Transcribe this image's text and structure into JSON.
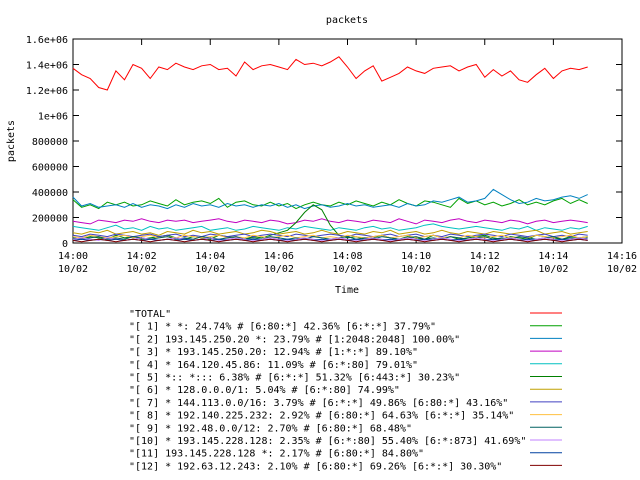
{
  "chart_data": {
    "type": "line",
    "title": "packets",
    "xlabel": "Time",
    "ylabel": "packets",
    "ylim": [
      0,
      1600000
    ],
    "xlim": [
      "14:00 10/02",
      "14:16 10/02"
    ],
    "grid": false,
    "legend_position": "below",
    "y_ticks": [
      0,
      200000,
      400000,
      600000,
      800000,
      1000000,
      1200000,
      1400000,
      1600000
    ],
    "y_tick_labels": [
      "0",
      "200000",
      "400000",
      "600000",
      "800000",
      "1e+06",
      "1.2e+06",
      "1.4e+06",
      "1.6e+06"
    ],
    "x_ticks": [
      0,
      2,
      4,
      6,
      8,
      10,
      12,
      14,
      16
    ],
    "x_tick_labels": [
      {
        "time": "14:00",
        "date": "10/02"
      },
      {
        "time": "14:02",
        "date": "10/02"
      },
      {
        "time": "14:04",
        "date": "10/02"
      },
      {
        "time": "14:06",
        "date": "10/02"
      },
      {
        "time": "14:08",
        "date": "10/02"
      },
      {
        "time": "14:10",
        "date": "10/02"
      },
      {
        "time": "14:12",
        "date": "10/02"
      },
      {
        "time": "14:14",
        "date": "10/02"
      },
      {
        "time": "14:16",
        "date": "10/02"
      }
    ],
    "x_minutes": [
      0,
      0.25,
      0.5,
      0.75,
      1,
      1.25,
      1.5,
      1.75,
      2,
      2.25,
      2.5,
      2.75,
      3,
      3.25,
      3.5,
      3.75,
      4,
      4.25,
      4.5,
      4.75,
      5,
      5.25,
      5.5,
      5.75,
      6,
      6.25,
      6.5,
      6.75,
      7,
      7.25,
      7.5,
      7.75,
      8,
      8.25,
      8.5,
      8.75,
      9,
      9.25,
      9.5,
      9.75,
      10,
      10.25,
      10.5,
      10.75,
      11,
      11.25,
      11.5,
      11.75,
      12,
      12.25,
      12.5,
      12.75,
      13,
      13.25,
      13.5,
      13.75,
      14,
      14.25,
      14.5,
      14.75,
      15
    ],
    "series": [
      {
        "name": "\"TOTAL\"",
        "color": "#ff0000",
        "values": [
          1370000,
          1320000,
          1290000,
          1220000,
          1200000,
          1350000,
          1280000,
          1400000,
          1370000,
          1290000,
          1380000,
          1360000,
          1410000,
          1380000,
          1360000,
          1390000,
          1400000,
          1360000,
          1370000,
          1310000,
          1420000,
          1360000,
          1390000,
          1400000,
          1380000,
          1360000,
          1440000,
          1400000,
          1410000,
          1390000,
          1420000,
          1460000,
          1380000,
          1290000,
          1350000,
          1390000,
          1270000,
          1300000,
          1330000,
          1380000,
          1350000,
          1330000,
          1370000,
          1380000,
          1390000,
          1350000,
          1380000,
          1400000,
          1300000,
          1360000,
          1310000,
          1350000,
          1280000,
          1260000,
          1320000,
          1370000,
          1290000,
          1350000,
          1370000,
          1360000,
          1380000
        ]
      },
      {
        "name": "\"[ 1] * *: 24.74% # [6:80:*] 42.36% [6:*:*] 37.79%\"",
        "color": "#00a000",
        "values": [
          340000,
          280000,
          300000,
          270000,
          320000,
          300000,
          320000,
          290000,
          300000,
          330000,
          310000,
          290000,
          340000,
          300000,
          320000,
          330000,
          310000,
          350000,
          280000,
          320000,
          330000,
          300000,
          290000,
          320000,
          290000,
          310000,
          270000,
          300000,
          320000,
          300000,
          290000,
          320000,
          300000,
          330000,
          310000,
          290000,
          320000,
          300000,
          340000,
          310000,
          290000,
          330000,
          320000,
          300000,
          280000,
          350000,
          310000,
          330000,
          300000,
          320000,
          290000,
          310000,
          340000,
          300000,
          320000,
          300000,
          330000,
          350000,
          310000,
          340000,
          310000
        ]
      },
      {
        "name": "\"[ 2] 193.145.250.20 *: 23.79% # [1:2048:2048] 100.00%\"",
        "color": "#0080c0",
        "values": [
          360000,
          290000,
          310000,
          280000,
          290000,
          300000,
          280000,
          310000,
          280000,
          300000,
          290000,
          270000,
          300000,
          280000,
          310000,
          290000,
          300000,
          280000,
          310000,
          290000,
          300000,
          280000,
          300000,
          290000,
          310000,
          280000,
          300000,
          270000,
          290000,
          300000,
          280000,
          290000,
          310000,
          290000,
          300000,
          280000,
          290000,
          300000,
          280000,
          310000,
          290000,
          300000,
          330000,
          320000,
          340000,
          360000,
          320000,
          330000,
          350000,
          420000,
          380000,
          340000,
          310000,
          320000,
          350000,
          330000,
          340000,
          360000,
          370000,
          350000,
          380000
        ]
      },
      {
        "name": "\"[ 3] * 193.145.250.20: 12.94% # [1:*:*] 89.10%\"",
        "color": "#c000c0",
        "values": [
          170000,
          160000,
          150000,
          180000,
          170000,
          160000,
          180000,
          170000,
          190000,
          170000,
          160000,
          180000,
          170000,
          180000,
          160000,
          170000,
          180000,
          190000,
          170000,
          160000,
          180000,
          170000,
          160000,
          180000,
          170000,
          150000,
          160000,
          180000,
          170000,
          190000,
          170000,
          160000,
          180000,
          170000,
          160000,
          180000,
          170000,
          160000,
          190000,
          170000,
          150000,
          180000,
          170000,
          160000,
          180000,
          190000,
          170000,
          160000,
          180000,
          170000,
          160000,
          180000,
          170000,
          150000,
          170000,
          180000,
          160000,
          170000,
          180000,
          170000,
          160000
        ]
      },
      {
        "name": "\"[ 4] * 164.120.45.86: 11.09% # [6:*:80] 79.01%\"",
        "color": "#00c0c0",
        "values": [
          130000,
          120000,
          110000,
          100000,
          120000,
          140000,
          110000,
          120000,
          100000,
          130000,
          110000,
          120000,
          100000,
          110000,
          120000,
          130000,
          100000,
          110000,
          120000,
          100000,
          110000,
          130000,
          120000,
          110000,
          100000,
          120000,
          110000,
          130000,
          120000,
          110000,
          100000,
          120000,
          110000,
          100000,
          120000,
          130000,
          110000,
          120000,
          100000,
          110000,
          120000,
          140000,
          150000,
          130000,
          120000,
          110000,
          120000,
          130000,
          120000,
          110000,
          100000,
          120000,
          110000,
          130000,
          100000,
          120000,
          110000,
          100000,
          120000,
          110000,
          130000
        ]
      },
      {
        "name": "\"[ 5] *:: *::: 6.38% # [6:*:*] 51.32% [6:443:*] 30.23%\"",
        "color": "#008000",
        "values": [
          40000,
          30000,
          50000,
          40000,
          30000,
          60000,
          40000,
          50000,
          30000,
          40000,
          50000,
          60000,
          40000,
          30000,
          50000,
          40000,
          30000,
          60000,
          50000,
          40000,
          30000,
          50000,
          40000,
          60000,
          80000,
          100000,
          160000,
          240000,
          300000,
          260000,
          140000,
          60000,
          40000,
          50000,
          30000,
          40000,
          60000,
          40000,
          30000,
          50000,
          40000,
          30000,
          60000,
          40000,
          50000,
          30000,
          40000,
          50000,
          60000,
          40000,
          30000,
          50000,
          40000,
          30000,
          60000,
          50000,
          40000,
          30000,
          50000,
          40000,
          50000
        ]
      },
      {
        "name": "\"[ 6] * 128.0.0.0/1: 5.04% # [6:*:80] 74.99%\"",
        "color": "#c0a000",
        "values": [
          80000,
          70000,
          90000,
          80000,
          100000,
          70000,
          80000,
          90000,
          70000,
          80000,
          60000,
          90000,
          80000,
          70000,
          100000,
          80000,
          90000,
          70000,
          80000,
          90000,
          70000,
          80000,
          100000,
          90000,
          70000,
          80000,
          90000,
          70000,
          80000,
          100000,
          80000,
          70000,
          90000,
          80000,
          70000,
          90000,
          80000,
          100000,
          70000,
          80000,
          90000,
          70000,
          80000,
          100000,
          80000,
          70000,
          90000,
          80000,
          70000,
          90000,
          80000,
          70000,
          80000,
          90000,
          100000,
          70000,
          80000,
          90000,
          70000,
          80000,
          90000
        ]
      },
      {
        "name": "\"[ 7] * 144.113.0.0/16: 3.79% # [6:*:*] 49.86% [6:80:*] 43.16%\"",
        "color": "#4040c0",
        "values": [
          60000,
          50000,
          70000,
          60000,
          50000,
          70000,
          60000,
          50000,
          60000,
          70000,
          50000,
          60000,
          70000,
          50000,
          60000,
          50000,
          70000,
          60000,
          50000,
          60000,
          70000,
          50000,
          60000,
          70000,
          60000,
          50000,
          70000,
          60000,
          50000,
          60000,
          70000,
          60000,
          50000,
          70000,
          60000,
          50000,
          60000,
          70000,
          50000,
          60000,
          70000,
          50000,
          60000,
          50000,
          70000,
          60000,
          50000,
          60000,
          70000,
          60000,
          50000,
          70000,
          60000,
          50000,
          60000,
          70000,
          50000,
          60000,
          50000,
          70000,
          60000
        ]
      },
      {
        "name": "\"[ 8] * 192.140.225.232: 2.92% # [6:80:*] 64.63% [6:*:*] 35.14%\"",
        "color": "#ffc040",
        "values": [
          50000,
          40000,
          60000,
          50000,
          40000,
          50000,
          60000,
          40000,
          50000,
          60000,
          40000,
          50000,
          40000,
          60000,
          50000,
          40000,
          50000,
          60000,
          40000,
          50000,
          40000,
          60000,
          50000,
          40000,
          50000,
          60000,
          40000,
          50000,
          60000,
          40000,
          50000,
          40000,
          60000,
          50000,
          40000,
          50000,
          60000,
          40000,
          50000,
          60000,
          40000,
          50000,
          60000,
          40000,
          50000,
          40000,
          60000,
          50000,
          40000,
          50000,
          60000,
          40000,
          50000,
          40000,
          60000,
          50000,
          40000,
          50000,
          60000,
          40000,
          50000
        ]
      },
      {
        "name": "\"[ 9] * 192.48.0.0/12: 2.70% # [6:80:*] 68.48%\"",
        "color": "#006060",
        "values": [
          40000,
          30000,
          40000,
          50000,
          30000,
          40000,
          30000,
          50000,
          40000,
          30000,
          40000,
          50000,
          30000,
          40000,
          30000,
          50000,
          40000,
          30000,
          40000,
          50000,
          30000,
          40000,
          30000,
          50000,
          40000,
          30000,
          40000,
          30000,
          50000,
          40000,
          30000,
          40000,
          50000,
          30000,
          40000,
          30000,
          50000,
          40000,
          30000,
          40000,
          50000,
          30000,
          40000,
          30000,
          50000,
          40000,
          30000,
          40000,
          50000,
          30000,
          40000,
          30000,
          50000,
          40000,
          30000,
          40000,
          50000,
          30000,
          40000,
          30000,
          40000
        ]
      },
      {
        "name": "\"[10] * 193.145.228.128: 2.35% # [6:*:80] 55.40% [6:*:873] 41.69%\"",
        "color": "#c080ff",
        "values": [
          30000,
          40000,
          30000,
          20000,
          40000,
          30000,
          20000,
          30000,
          40000,
          30000,
          20000,
          30000,
          40000,
          30000,
          20000,
          30000,
          40000,
          20000,
          30000,
          40000,
          30000,
          20000,
          30000,
          40000,
          30000,
          20000,
          30000,
          40000,
          30000,
          20000,
          30000,
          40000,
          30000,
          20000,
          30000,
          40000,
          30000,
          20000,
          30000,
          40000,
          30000,
          20000,
          30000,
          40000,
          30000,
          20000,
          30000,
          40000,
          30000,
          20000,
          30000,
          40000,
          30000,
          20000,
          30000,
          40000,
          30000,
          20000,
          30000,
          40000,
          30000
        ]
      },
      {
        "name": "\"[11] 193.145.228.128 *: 2.17% # [6:80:*] 84.80%\"",
        "color": "#0040a0",
        "values": [
          20000,
          30000,
          20000,
          30000,
          20000,
          30000,
          20000,
          30000,
          20000,
          30000,
          20000,
          30000,
          20000,
          30000,
          20000,
          30000,
          20000,
          30000,
          20000,
          30000,
          20000,
          30000,
          20000,
          30000,
          20000,
          30000,
          20000,
          30000,
          20000,
          30000,
          20000,
          30000,
          20000,
          30000,
          20000,
          30000,
          20000,
          30000,
          20000,
          30000,
          20000,
          30000,
          20000,
          30000,
          20000,
          30000,
          20000,
          30000,
          20000,
          30000,
          20000,
          30000,
          20000,
          30000,
          20000,
          30000,
          20000,
          30000,
          20000,
          30000,
          20000
        ]
      },
      {
        "name": "\"[12] * 192.63.12.243: 2.10% # [6:80:*] 69.26% [6:*:*] 30.30%\"",
        "color": "#800000",
        "values": [
          20000,
          10000,
          20000,
          30000,
          20000,
          10000,
          20000,
          30000,
          20000,
          10000,
          20000,
          30000,
          20000,
          10000,
          20000,
          30000,
          20000,
          10000,
          20000,
          30000,
          20000,
          10000,
          20000,
          30000,
          20000,
          10000,
          20000,
          30000,
          20000,
          10000,
          20000,
          30000,
          20000,
          10000,
          20000,
          30000,
          20000,
          10000,
          20000,
          30000,
          20000,
          10000,
          20000,
          30000,
          20000,
          10000,
          20000,
          30000,
          20000,
          10000,
          20000,
          30000,
          20000,
          10000,
          20000,
          30000,
          20000,
          10000,
          20000,
          30000,
          20000
        ]
      }
    ]
  }
}
